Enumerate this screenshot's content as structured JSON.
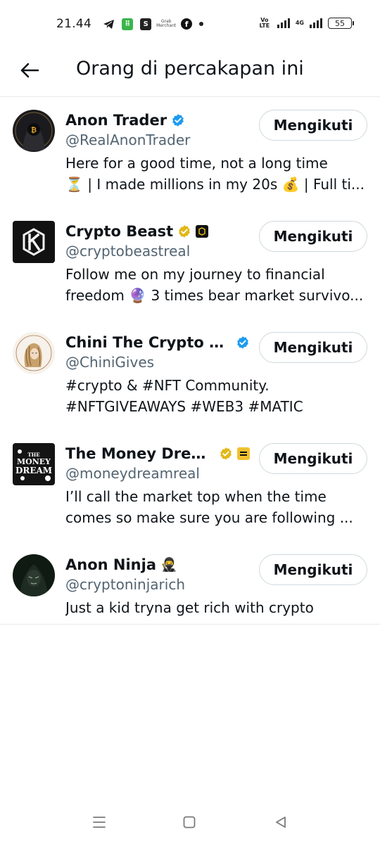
{
  "status_bar": {
    "time": "21.44",
    "icons": [
      "telegram-icon",
      "green-app-icon",
      "shopee-icon",
      "grab-merchant-icon",
      "facebook-icon",
      "dot-icon"
    ],
    "grab_text": "Grab Merchant",
    "volte": "Vo LTE",
    "network": "4G",
    "battery": "55"
  },
  "header": {
    "back_icon": "arrow-left-icon",
    "title": "Orang di percakapan ini"
  },
  "users": [
    {
      "name": "Anon Trader",
      "handle": "@RealAnonTrader",
      "badge": "blue-check",
      "bio": [
        "Here for a good time, not a long time",
        "⏳ | I made millions in my 20s 💰 | Full ti..."
      ],
      "button": "Mengikuti"
    },
    {
      "name": "Crypto Beast",
      "handle": "@cryptobeastreal",
      "badge": "gold-check",
      "bio": [
        "Follow me on my journey to financial",
        "freedom 🔮 3 times bear market survivo..."
      ],
      "button": "Mengikuti"
    },
    {
      "name": "Chini The Crypto Q...",
      "handle": "@ChiniGives",
      "badge": "blue-check",
      "bio": [
        "#crypto & #NFT Community.",
        "#NFTGIVEAWAYS #WEB3 #MATIC"
      ],
      "button": "Mengikuti"
    },
    {
      "name": "The Money Dream",
      "handle": "@moneydreamreal",
      "badge": "gold-check",
      "bio": [
        "I’ll call the market top when the time",
        "comes so make sure you are following ..."
      ],
      "button": "Mengikuti"
    },
    {
      "name": "Anon Ninja",
      "handle": "@cryptoninjarich",
      "name_emoji": "🥷",
      "bio": [
        "Just a kid tryna get rich with crypto"
      ],
      "button": "Mengikuti"
    }
  ],
  "avatar_texts": {
    "money_dream": [
      "THE",
      "MONEY",
      "DREAM"
    ]
  },
  "colors": {
    "verified_blue": "#1d9bf0",
    "verified_gold": "#e2b719",
    "text_primary": "#0f1419",
    "text_secondary": "#536471",
    "border": "#cfd9de"
  },
  "navbar": {
    "icons": [
      "recent-apps-icon",
      "home-icon",
      "back-icon"
    ]
  }
}
